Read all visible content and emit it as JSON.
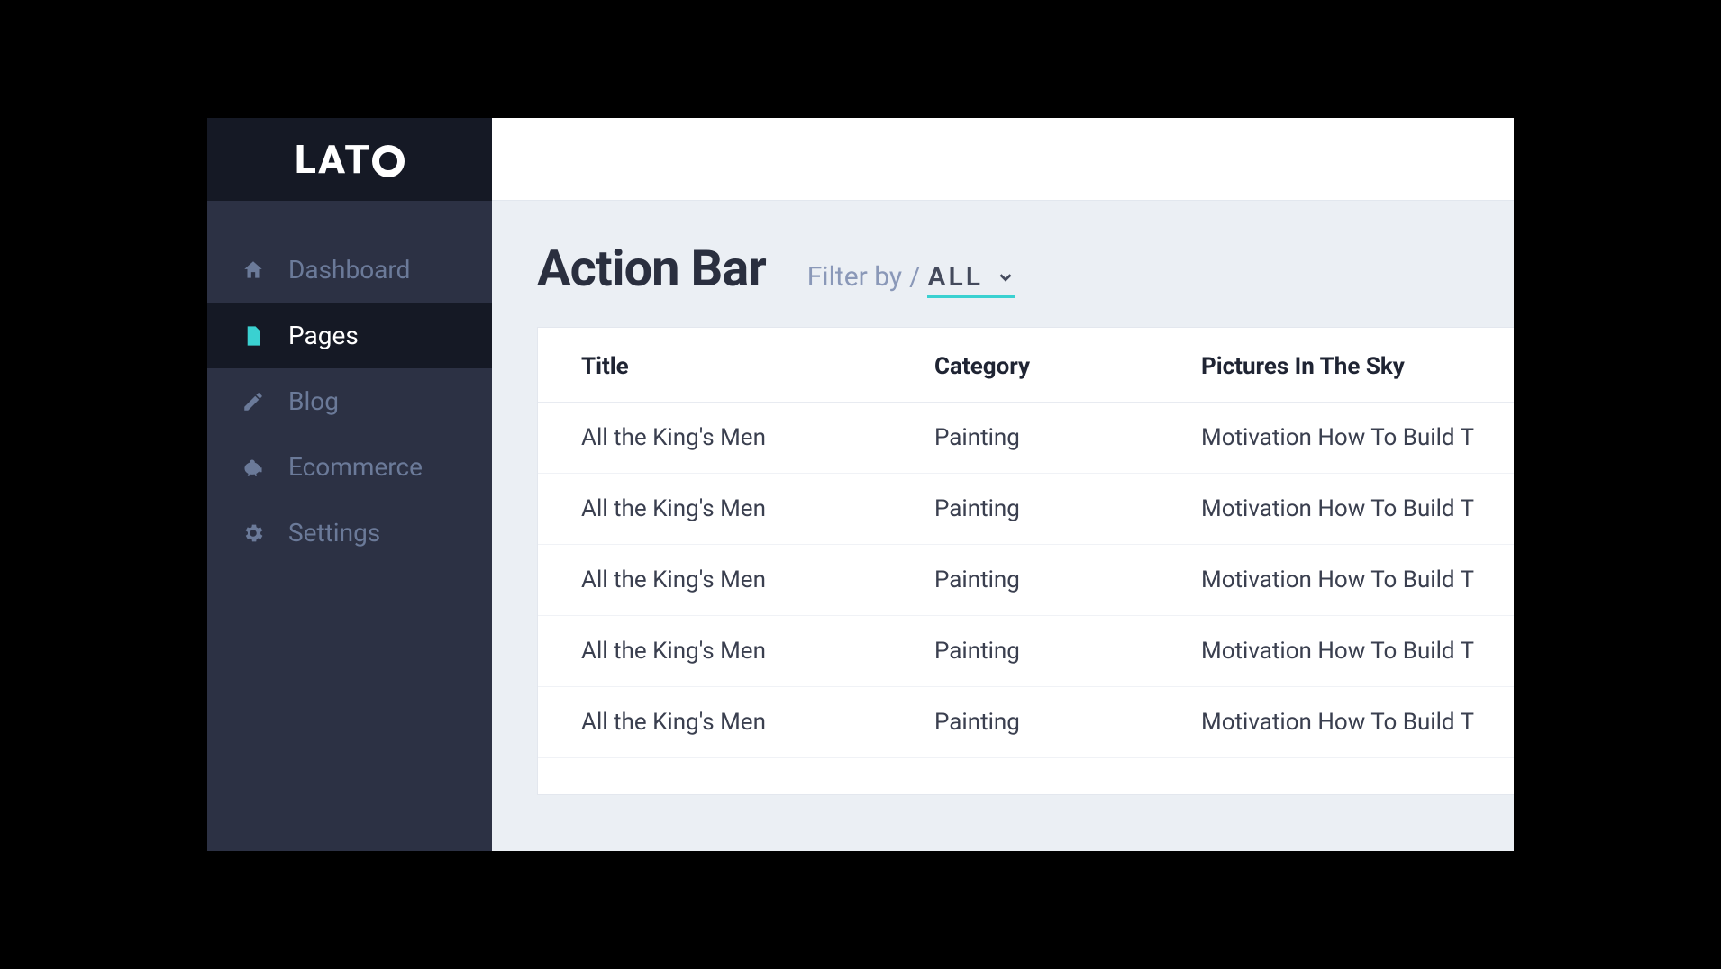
{
  "brand": {
    "name": "LATO"
  },
  "sidebar": {
    "items": [
      {
        "id": "dashboard",
        "label": "Dashboard",
        "icon": "home",
        "active": false
      },
      {
        "id": "pages",
        "label": "Pages",
        "icon": "file",
        "active": true
      },
      {
        "id": "blog",
        "label": "Blog",
        "icon": "edit",
        "active": false
      },
      {
        "id": "ecommerce",
        "label": "Ecommerce",
        "icon": "piggy",
        "active": false
      },
      {
        "id": "settings",
        "label": "Settings",
        "icon": "gear",
        "active": false
      }
    ]
  },
  "page": {
    "title": "Action Bar",
    "filter": {
      "label": "Filter by",
      "value": "ALL"
    }
  },
  "table": {
    "columns": [
      "Title",
      "Category",
      "Pictures In The Sky"
    ],
    "rows": [
      {
        "title": "All the King's Men",
        "category": "Painting",
        "pictures": "Motivation How To Build T"
      },
      {
        "title": "All the King's Men",
        "category": "Painting",
        "pictures": "Motivation How To Build T"
      },
      {
        "title": "All the King's Men",
        "category": "Painting",
        "pictures": "Motivation How To Build T"
      },
      {
        "title": "All the King's Men",
        "category": "Painting",
        "pictures": "Motivation How To Build T"
      },
      {
        "title": "All the King's Men",
        "category": "Painting",
        "pictures": "Motivation How To Build T"
      }
    ]
  }
}
